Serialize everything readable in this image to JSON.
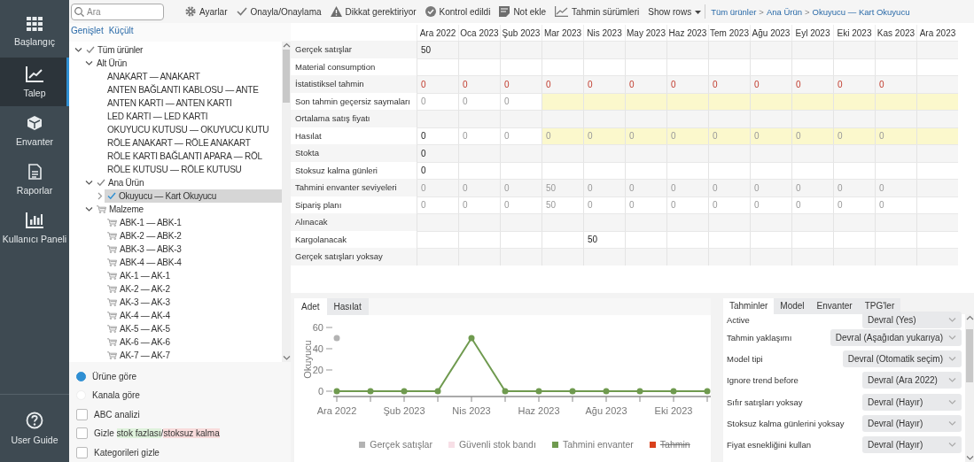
{
  "nav": {
    "items": [
      {
        "label": "Başlangıç",
        "kind": "home",
        "selected": false
      },
      {
        "label": "Talep",
        "kind": "demand",
        "selected": true
      },
      {
        "label": "Envanter",
        "kind": "inventory",
        "selected": false
      },
      {
        "label": "Raporlar",
        "kind": "reports",
        "selected": false
      },
      {
        "label": "Kullanıcı Paneli",
        "kind": "dashboard",
        "selected": false
      }
    ],
    "footer": {
      "label": "User Guide",
      "kind": "help"
    }
  },
  "search": {
    "placeholder": "Ara"
  },
  "toolbar": {
    "buttons": [
      {
        "label": "Ayarlar",
        "kind": "settings"
      },
      {
        "label": "Onayla/Onaylama",
        "kind": "approve"
      },
      {
        "label": "Dikkat gerektiriyor",
        "kind": "warning"
      },
      {
        "label": "Kontrol edildi",
        "kind": "checked"
      },
      {
        "label": "Not ekle",
        "kind": "note"
      },
      {
        "label": "Tahmin sürümleri",
        "kind": "versions"
      }
    ],
    "show_rows": "Show rows",
    "breadcrumb": {
      "items": [
        "Tüm ürünler",
        "Ana Ürün",
        "Okuyucu — Kart Okuyucu"
      ],
      "separator": ">"
    }
  },
  "tree_actions": [
    "Genişlet",
    "Küçült"
  ],
  "tree": [
    {
      "label": "Tüm ürünler",
      "kind": "approved",
      "expanded": true,
      "selected": false,
      "children": [
        {
          "label": "Alt Ürün",
          "kind": "group",
          "expanded": true,
          "selected": false,
          "children": [
            {
              "label": "ANAKART — ANAKART",
              "kind": "item",
              "selected": false
            },
            {
              "label": "ANTEN BAĞLANTI KABLOSU — ANTE",
              "kind": "item",
              "selected": false
            },
            {
              "label": "ANTEN KARTI — ANTEN KARTI",
              "kind": "item",
              "selected": false
            },
            {
              "label": "LED KARTI — LED KARTI",
              "kind": "item",
              "selected": false
            },
            {
              "label": "OKUYUCU KUTUSU — OKUYUCU KUTU",
              "kind": "item",
              "selected": false
            },
            {
              "label": "RÖLE ANAKART — RÖLE ANAKART",
              "kind": "item",
              "selected": false
            },
            {
              "label": "RÖLE KARTI BAĞLANTI APARA — RÖL",
              "kind": "item",
              "selected": false
            },
            {
              "label": "RÖLE KUTUSU — RÖLE KUTUSU",
              "kind": "item",
              "selected": false
            }
          ]
        },
        {
          "label": "Ana Ürün",
          "kind": "approved",
          "expanded": true,
          "selected": false,
          "children": [
            {
              "label": "Okuyucu — Kart Okuyucu",
              "kind": "approved",
              "expanded": false,
              "selected": true
            }
          ]
        },
        {
          "label": "Malzeme",
          "kind": "material",
          "expanded": true,
          "selected": false,
          "children": [
            {
              "label": "ABK-1 — ABK-1",
              "kind": "material",
              "selected": false
            },
            {
              "label": "ABK-2 — ABK-2",
              "kind": "material",
              "selected": false
            },
            {
              "label": "ABK-3 — ABK-3",
              "kind": "material",
              "selected": false
            },
            {
              "label": "ABK-4 — ABK-4",
              "kind": "material",
              "selected": false
            },
            {
              "label": "AK-1 — AK-1",
              "kind": "material",
              "selected": false
            },
            {
              "label": "AK-2 — AK-2",
              "kind": "material",
              "selected": false
            },
            {
              "label": "AK-3 — AK-3",
              "kind": "material",
              "selected": false
            },
            {
              "label": "AK-4 — AK-4",
              "kind": "material",
              "selected": false
            },
            {
              "label": "AK-5 — AK-5",
              "kind": "material",
              "selected": false
            },
            {
              "label": "AK-6 — AK-6",
              "kind": "material",
              "selected": false
            },
            {
              "label": "AK-7 — AK-7",
              "kind": "material",
              "selected": false
            }
          ]
        }
      ]
    }
  ],
  "view_options": [
    {
      "label": "Ürüne göre",
      "selected": true
    },
    {
      "label": "Kanala göre",
      "selected": false
    }
  ],
  "filters": [
    {
      "label_parts": [
        {
          "text": "ABC analizi"
        }
      ],
      "checked": false
    },
    {
      "label_parts": [
        {
          "text": "Gizle "
        },
        {
          "text": "stok fazlası",
          "kind": "excess"
        },
        {
          "text": "/"
        },
        {
          "text": "stoksuz kalma",
          "kind": "shortage"
        }
      ],
      "checked": false
    },
    {
      "label_parts": [
        {
          "text": "Kategorileri gizle"
        }
      ],
      "checked": false
    }
  ],
  "table": {
    "columns": [
      "Ara 2022",
      "Oca 2023",
      "Şub 2023",
      "Mar 2023",
      "Nis 2023",
      "May 2023",
      "Haz 2023",
      "Tem 2023",
      "Ağu 2023",
      "Eyl 2023",
      "Eki 2023",
      "Kas 2023",
      "Ara 2023"
    ],
    "rows": [
      {
        "label": "Gerçek satışlar",
        "cells": [
          {
            "text": "50",
            "kind": "strong",
            "highlighted": false
          },
          {
            "highlighted": false
          },
          {
            "highlighted": false
          },
          {
            "highlighted": false
          },
          {
            "highlighted": false
          },
          {
            "highlighted": false
          },
          {
            "highlighted": false
          },
          {
            "highlighted": false
          },
          {
            "highlighted": false
          },
          {
            "highlighted": false
          },
          {
            "highlighted": false
          },
          {
            "highlighted": false
          },
          {
            "highlighted": false
          }
        ]
      },
      {
        "label": "Material consumption",
        "cells": [
          {
            "highlighted": false
          },
          {
            "highlighted": false
          },
          {
            "highlighted": false
          },
          {
            "highlighted": false
          },
          {
            "highlighted": false
          },
          {
            "highlighted": false
          },
          {
            "highlighted": false
          },
          {
            "highlighted": false
          },
          {
            "highlighted": false
          },
          {
            "highlighted": false
          },
          {
            "highlighted": false
          },
          {
            "highlighted": false
          },
          {
            "highlighted": false
          }
        ]
      },
      {
        "label": "İstatistiksel tahmin",
        "cells": [
          {
            "text": "0",
            "kind": "alert",
            "highlighted": false
          },
          {
            "text": "0",
            "kind": "alert",
            "highlighted": false
          },
          {
            "text": "0",
            "kind": "alert",
            "highlighted": false
          },
          {
            "text": "0",
            "kind": "alert",
            "highlighted": false
          },
          {
            "text": "0",
            "kind": "alert",
            "highlighted": false
          },
          {
            "text": "0",
            "kind": "alert",
            "highlighted": false
          },
          {
            "text": "0",
            "kind": "alert",
            "highlighted": false
          },
          {
            "text": "0",
            "kind": "alert",
            "highlighted": false
          },
          {
            "text": "0",
            "kind": "alert",
            "highlighted": false
          },
          {
            "text": "0",
            "kind": "alert",
            "highlighted": false
          },
          {
            "text": "0",
            "kind": "alert",
            "highlighted": false
          },
          {
            "text": "0",
            "kind": "alert",
            "highlighted": false
          },
          {
            "highlighted": false
          }
        ]
      },
      {
        "label": "Son tahmin geçersiz saymaları",
        "cells": [
          {
            "text": "0",
            "kind": "muted",
            "highlighted": false
          },
          {
            "text": "0",
            "kind": "muted",
            "highlighted": false
          },
          {
            "text": "0",
            "kind": "muted",
            "highlighted": false
          },
          {
            "highlighted": true
          },
          {
            "highlighted": true
          },
          {
            "highlighted": true
          },
          {
            "highlighted": true
          },
          {
            "highlighted": true
          },
          {
            "highlighted": true
          },
          {
            "highlighted": true
          },
          {
            "highlighted": true
          },
          {
            "highlighted": true
          },
          {
            "highlighted": true
          }
        ]
      },
      {
        "label": "Ortalama satış fiyatı",
        "cells": [
          {
            "highlighted": false
          },
          {
            "highlighted": false
          },
          {
            "highlighted": false
          },
          {
            "highlighted": false
          },
          {
            "highlighted": false
          },
          {
            "highlighted": false
          },
          {
            "highlighted": false
          },
          {
            "highlighted": false
          },
          {
            "highlighted": false
          },
          {
            "highlighted": false
          },
          {
            "highlighted": false
          },
          {
            "highlighted": false
          },
          {
            "highlighted": false
          }
        ]
      },
      {
        "label": "Hasılat",
        "cells": [
          {
            "text": "0",
            "kind": "strong",
            "highlighted": false
          },
          {
            "text": "0",
            "kind": "muted",
            "highlighted": false
          },
          {
            "text": "0",
            "kind": "muted",
            "highlighted": false
          },
          {
            "text": "0",
            "kind": "muted",
            "highlighted": true
          },
          {
            "text": "0",
            "kind": "muted",
            "highlighted": true
          },
          {
            "text": "0",
            "kind": "muted",
            "highlighted": true
          },
          {
            "text": "0",
            "kind": "muted",
            "highlighted": true
          },
          {
            "text": "0",
            "kind": "muted",
            "highlighted": true
          },
          {
            "text": "0",
            "kind": "muted",
            "highlighted": true
          },
          {
            "text": "0",
            "kind": "muted",
            "highlighted": true
          },
          {
            "text": "0",
            "kind": "muted",
            "highlighted": true
          },
          {
            "text": "0",
            "kind": "muted",
            "highlighted": true
          },
          {
            "highlighted": true
          }
        ]
      },
      {
        "label": "Stokta",
        "cells": [
          {
            "text": "0",
            "kind": "strong",
            "highlighted": false
          },
          {
            "highlighted": false
          },
          {
            "highlighted": false
          },
          {
            "highlighted": false
          },
          {
            "highlighted": false
          },
          {
            "highlighted": false
          },
          {
            "highlighted": false
          },
          {
            "highlighted": false
          },
          {
            "highlighted": false
          },
          {
            "highlighted": false
          },
          {
            "highlighted": false
          },
          {
            "highlighted": false
          },
          {
            "highlighted": false
          }
        ]
      },
      {
        "label": "Stoksuz kalma günleri",
        "cells": [
          {
            "text": "0",
            "kind": "strong",
            "highlighted": false
          },
          {
            "highlighted": false
          },
          {
            "highlighted": false
          },
          {
            "highlighted": false
          },
          {
            "highlighted": false
          },
          {
            "highlighted": false
          },
          {
            "highlighted": false
          },
          {
            "highlighted": false
          },
          {
            "highlighted": false
          },
          {
            "highlighted": false
          },
          {
            "highlighted": false
          },
          {
            "highlighted": false
          },
          {
            "highlighted": false
          }
        ]
      },
      {
        "label": "Tahmini envanter seviyeleri",
        "cells": [
          {
            "text": "0",
            "kind": "muted",
            "highlighted": false
          },
          {
            "text": "0",
            "kind": "muted",
            "highlighted": false
          },
          {
            "text": "0",
            "kind": "muted",
            "highlighted": false
          },
          {
            "text": "50",
            "kind": "muted",
            "highlighted": false
          },
          {
            "text": "0",
            "kind": "muted",
            "highlighted": false
          },
          {
            "text": "0",
            "kind": "muted",
            "highlighted": false
          },
          {
            "text": "0",
            "kind": "muted",
            "highlighted": false
          },
          {
            "text": "0",
            "kind": "muted",
            "highlighted": false
          },
          {
            "text": "0",
            "kind": "muted",
            "highlighted": false
          },
          {
            "text": "0",
            "kind": "muted",
            "highlighted": false
          },
          {
            "text": "0",
            "kind": "muted",
            "highlighted": false
          },
          {
            "text": "0",
            "kind": "muted",
            "highlighted": false
          },
          {
            "highlighted": false
          }
        ]
      },
      {
        "label": "Sipariş planı",
        "cells": [
          {
            "text": "0",
            "kind": "muted",
            "highlighted": false
          },
          {
            "text": "0",
            "kind": "muted",
            "highlighted": false
          },
          {
            "text": "0",
            "kind": "muted",
            "highlighted": false
          },
          {
            "text": "50",
            "kind": "muted",
            "highlighted": false
          },
          {
            "text": "0",
            "kind": "muted",
            "highlighted": false
          },
          {
            "text": "0",
            "kind": "muted",
            "highlighted": false
          },
          {
            "text": "0",
            "kind": "muted",
            "highlighted": false
          },
          {
            "text": "0",
            "kind": "muted",
            "highlighted": false
          },
          {
            "text": "0",
            "kind": "muted",
            "highlighted": false
          },
          {
            "text": "0",
            "kind": "muted",
            "highlighted": false
          },
          {
            "text": "0",
            "kind": "muted",
            "highlighted": false
          },
          {
            "text": "0",
            "kind": "muted",
            "highlighted": false
          },
          {
            "highlighted": false
          }
        ]
      },
      {
        "label": "Alınacak",
        "cells": [
          {
            "highlighted": false
          },
          {
            "highlighted": false
          },
          {
            "highlighted": false
          },
          {
            "highlighted": false
          },
          {
            "highlighted": false
          },
          {
            "highlighted": false
          },
          {
            "highlighted": false
          },
          {
            "highlighted": false
          },
          {
            "highlighted": false
          },
          {
            "highlighted": false
          },
          {
            "highlighted": false
          },
          {
            "highlighted": false
          },
          {
            "highlighted": false
          }
        ]
      },
      {
        "label": "Kargolanacak",
        "cells": [
          {
            "highlighted": false
          },
          {
            "highlighted": false
          },
          {
            "highlighted": false
          },
          {
            "highlighted": false
          },
          {
            "text": "50",
            "kind": "strong",
            "highlighted": false
          },
          {
            "highlighted": false
          },
          {
            "highlighted": false
          },
          {
            "highlighted": false
          },
          {
            "highlighted": false
          },
          {
            "highlighted": false
          },
          {
            "highlighted": false
          },
          {
            "highlighted": false
          },
          {
            "highlighted": false
          }
        ]
      },
      {
        "label": "Gerçek satışları yoksay",
        "cells": [
          {
            "highlighted": false
          },
          {
            "highlighted": false
          },
          {
            "highlighted": false
          },
          {
            "highlighted": false
          },
          {
            "highlighted": false
          },
          {
            "highlighted": false
          },
          {
            "highlighted": false
          },
          {
            "highlighted": false
          },
          {
            "highlighted": false
          },
          {
            "highlighted": false
          },
          {
            "highlighted": false
          },
          {
            "highlighted": false
          },
          {
            "highlighted": false
          }
        ]
      }
    ]
  },
  "chart_tabs": [
    {
      "label": "Adet",
      "selected": true
    },
    {
      "label": "Hasılat",
      "selected": false
    }
  ],
  "chart": {
    "chart_data": {
      "type": "line",
      "ylabel": "Okuyucu",
      "categories": [
        "Ara 2022",
        null,
        "Şub 2023",
        null,
        "Nis 2023",
        null,
        "Haz 2023",
        null,
        "Ağu 2023",
        null,
        "Eki 2023",
        null
      ],
      "ylim": [
        0,
        60
      ],
      "yticks": [
        0,
        20,
        40,
        60
      ],
      "series": [
        {
          "name": "Gerçek satışlar",
          "color": "#b3b3b3",
          "marker": "circle",
          "values": [
            50,
            null,
            null,
            null,
            null,
            null,
            null,
            null,
            null,
            null,
            null,
            null
          ]
        },
        {
          "name": "Güvenli stok bandı",
          "color": "#f7dfe6",
          "values": [
            null,
            null,
            null,
            null,
            null,
            null,
            null,
            null,
            null,
            null,
            null,
            null
          ]
        },
        {
          "name": "Tahmini envanter",
          "color": "#6f9a4f",
          "marker": "circle",
          "values": [
            0,
            0,
            0,
            0,
            50,
            0,
            0,
            0,
            0,
            0,
            0,
            0
          ]
        },
        {
          "name": "Tahmin",
          "color": "#d9401c",
          "values": [
            null,
            null,
            null,
            null,
            null,
            null,
            null,
            null,
            null,
            null,
            null,
            null
          ]
        }
      ]
    },
    "legend_states": [
      {
        "hidden": false
      },
      {
        "hidden": false
      },
      {
        "hidden": false
      },
      {
        "hidden": true
      }
    ]
  },
  "settings": {
    "tabs": [
      {
        "label": "Tahminler",
        "selected": true
      },
      {
        "label": "Model",
        "selected": false
      },
      {
        "label": "Envanter",
        "selected": false
      },
      {
        "label": "TPG'ler",
        "selected": false
      }
    ],
    "rows": [
      {
        "label": "Active",
        "value": "Devral (Yes)"
      },
      {
        "label": "Tahmin yaklaşımı",
        "value": "Devral (Aşağıdan yukarıya)"
      },
      {
        "label": "Model tipi",
        "value": "Devral (Otomatik seçim)"
      },
      {
        "label": "Ignore trend before",
        "value": "Devral (Ara 2022)"
      },
      {
        "label": "Sıfır satışları yoksay",
        "value": "Devral (Hayır)"
      },
      {
        "label": "Stoksuz kalma günlerini yoksay",
        "value": "Devral (Hayır)"
      },
      {
        "label": "Fiyat esnekliğini kullan",
        "value": "Devral (Hayır)"
      }
    ]
  }
}
